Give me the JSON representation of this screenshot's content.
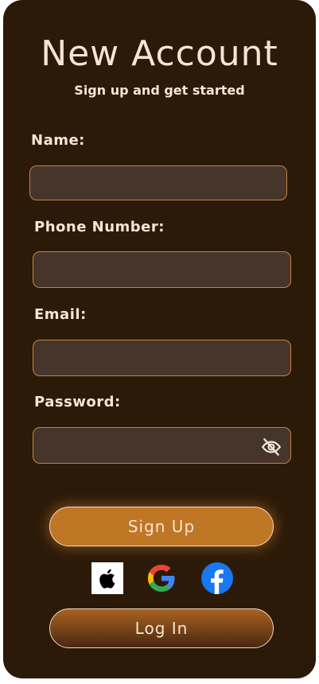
{
  "header": {
    "title": "New Account",
    "subtitle": "Sign up and get started"
  },
  "form": {
    "name_label": "Name:",
    "name_value": "",
    "phone_label": "Phone Number:",
    "phone_value": "",
    "email_label": "Email:",
    "email_value": "",
    "password_label": "Password:",
    "password_value": "",
    "password_toggle_icon": "eye-off-icon"
  },
  "actions": {
    "signup_label": "Sign Up",
    "login_label": "Log In"
  },
  "social": {
    "icons": [
      "apple-icon",
      "google-icon",
      "facebook-icon"
    ]
  },
  "colors": {
    "background": "#2c1a09",
    "input_fill": "#46352b",
    "accent_border": "#c9813b",
    "signup_button": "#bf7625",
    "text": "#f3e6d6",
    "facebook_blue": "#1877f2"
  }
}
